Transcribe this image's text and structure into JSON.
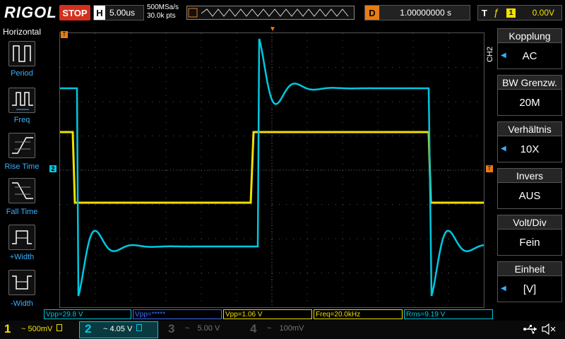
{
  "topbar": {
    "logo": "RIGOL",
    "run_state": "STOP",
    "horiz_letter": "H",
    "timebase": "5.00us",
    "sample_rate": "500MSa/s",
    "points": "30.0k pts",
    "delay_letter": "D",
    "delay_value": "1.00000000 s",
    "trig_letter": "T",
    "trig_edge_icon": "rising-edge-icon",
    "trig_source": "1",
    "trig_level": "0.00V"
  },
  "left_menu": {
    "title": "Horizontal",
    "items": [
      {
        "label": "Period",
        "icon": "period-icon"
      },
      {
        "label": "Freq",
        "icon": "freq-icon"
      },
      {
        "label": "Rise Time",
        "icon": "rise-time-icon"
      },
      {
        "label": "Fall Time",
        "icon": "fall-time-icon"
      },
      {
        "label": "+Width",
        "icon": "pos-width-icon"
      },
      {
        "label": "-Width",
        "icon": "neg-width-icon"
      }
    ]
  },
  "markers": {
    "trigger_top": "▼",
    "ch1_left": "T",
    "ch2_left": "2",
    "trig_level_right": "T"
  },
  "right_menu": {
    "channel_label": "CH2",
    "items": [
      {
        "label": "Kopplung",
        "value": "AC",
        "has_arrow": true
      },
      {
        "label": "BW Grenzw.",
        "value": "20M",
        "has_arrow": false
      },
      {
        "label": "Verhältnis",
        "value": "10X",
        "has_arrow": true
      },
      {
        "label": "Invers",
        "value": "AUS",
        "has_arrow": false
      },
      {
        "label": "Volt/Div",
        "value": "Fein",
        "has_arrow": false
      },
      {
        "label": "Einheit",
        "value": "[V]",
        "has_arrow": true
      }
    ]
  },
  "measurements": [
    {
      "text": "Vpp=29.8 V",
      "color": "#00c8e0"
    },
    {
      "text": "Vpp=*****",
      "color": "#3a6cff"
    },
    {
      "text": "Vpp=1.06 V",
      "color": "#f0e000"
    },
    {
      "text": "Freq=20.0kHz",
      "color": "#f0e000"
    },
    {
      "text": "Rms=9.19 V",
      "color": "#00c8e0"
    }
  ],
  "channels": [
    {
      "num": "1",
      "coupling": "~",
      "scale": "500mV",
      "color": "#f0e000",
      "active": false
    },
    {
      "num": "2",
      "coupling": "~",
      "scale": "4.05 V",
      "color": "#00c8e0",
      "active": true
    },
    {
      "num": "3",
      "coupling": "~",
      "scale": "5.00 V",
      "color": "#b0308c",
      "active": false
    },
    {
      "num": "4",
      "coupling": "~",
      "scale": "100mV",
      "color": "#3a6cff",
      "active": false
    }
  ],
  "status_icons": [
    "usb-icon",
    "speaker-mute-icon"
  ],
  "colors": {
    "ch1": "#f0e000",
    "ch2": "#00c8e0",
    "accent_orange": "#e87b12",
    "stop_red": "#d4301e"
  }
}
